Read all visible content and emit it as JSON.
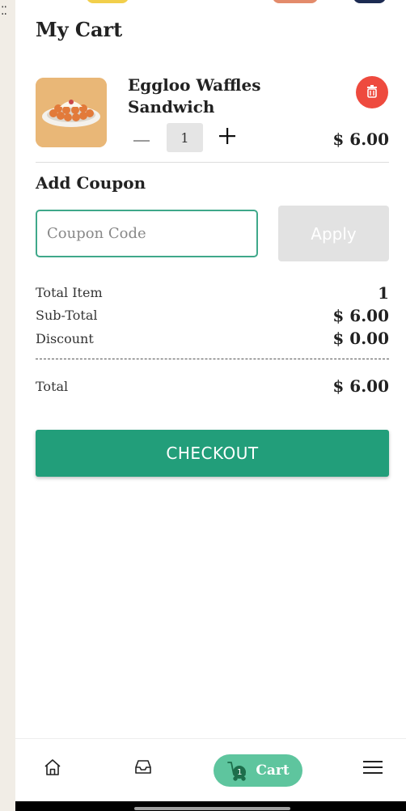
{
  "header": {
    "title": "My Cart"
  },
  "cart": {
    "items": [
      {
        "name": "Eggloo Waffles Sandwich",
        "quantity": "1",
        "price": "$ 6.00",
        "minus_icon": "minus-icon",
        "plus_icon": "plus-icon",
        "delete_icon": "trash-icon"
      }
    ]
  },
  "coupon": {
    "heading": "Add Coupon",
    "placeholder": "Coupon Code",
    "value": "",
    "apply_label": "Apply"
  },
  "summary": {
    "total_item_label": "Total Item",
    "total_item_value": "1",
    "subtotal_label": "Sub-Total",
    "subtotal_value": "$ 6.00",
    "discount_label": "Discount",
    "discount_value": "$ 0.00",
    "total_label": "Total",
    "total_value": "$ 6.00"
  },
  "checkout": {
    "label": "CHECKOUT"
  },
  "bottom_nav": {
    "items": [
      {
        "icon": "home-icon"
      },
      {
        "icon": "inbox-icon"
      },
      {
        "icon": "cart-icon",
        "label": "Cart",
        "badge": "1",
        "active": true
      },
      {
        "icon": "menu-icon"
      }
    ]
  },
  "colors": {
    "accent": "#229e7a",
    "active_nav": "#5ec59e",
    "delete": "#ee4a3e",
    "input_border": "#3fa88a",
    "apply_disabled": "#e2e2e2"
  }
}
